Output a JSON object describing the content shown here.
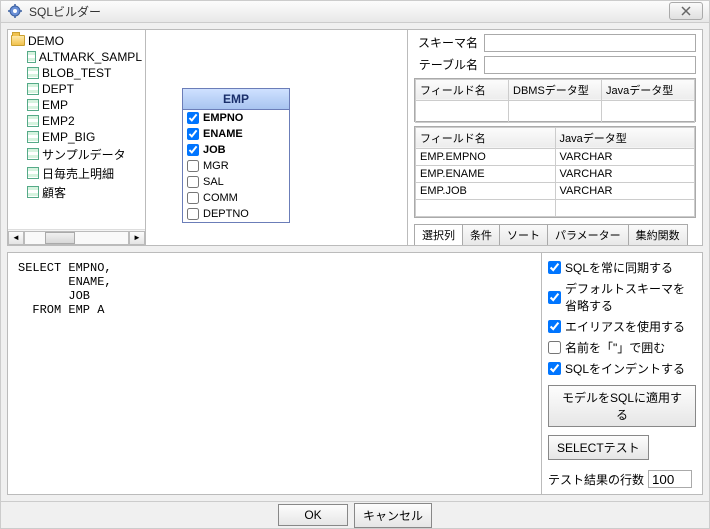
{
  "title": "SQLビルダー",
  "tree": {
    "root": "DEMO",
    "items": [
      "ALTMARK_SAMPL",
      "BLOB_TEST",
      "DEPT",
      "EMP",
      "EMP2",
      "EMP_BIG",
      "サンプルデータ",
      "日毎売上明細",
      "顧客"
    ]
  },
  "entity": {
    "name": "EMP",
    "columns": [
      {
        "name": "EMPNO",
        "checked": true,
        "bold": true
      },
      {
        "name": "ENAME",
        "checked": true,
        "bold": true
      },
      {
        "name": "JOB",
        "checked": true,
        "bold": true
      },
      {
        "name": "MGR",
        "checked": false,
        "bold": false
      },
      {
        "name": "SAL",
        "checked": false,
        "bold": false
      },
      {
        "name": "COMM",
        "checked": false,
        "bold": false
      },
      {
        "name": "DEPTNO",
        "checked": false,
        "bold": false
      }
    ]
  },
  "right": {
    "schema_label": "スキーマ名",
    "schema_value": "",
    "table_label": "テーブル名",
    "table_value": "",
    "grid1_headers": [
      "フィールド名",
      "DBMSデータ型",
      "Javaデータ型"
    ],
    "grid2_headers": [
      "フィールド名",
      "Javaデータ型"
    ],
    "grid2_rows": [
      {
        "field": "EMP.EMPNO",
        "java": "VARCHAR"
      },
      {
        "field": "EMP.ENAME",
        "java": "VARCHAR"
      },
      {
        "field": "EMP.JOB",
        "java": "VARCHAR"
      },
      {
        "field": "",
        "java": ""
      }
    ],
    "tabs": [
      "選択列",
      "条件",
      "ソート",
      "パラメーター",
      "集約関数"
    ]
  },
  "sql": "SELECT EMPNO,\n       ENAME,\n       JOB\n  FROM EMP A",
  "options": {
    "chk1": {
      "label": "SQLを常に同期する",
      "checked": true
    },
    "chk2": {
      "label": "デフォルトスキーマを省略する",
      "checked": true
    },
    "chk3": {
      "label": "エイリアスを使用する",
      "checked": true
    },
    "chk4": {
      "label": "名前を「\"」で囲む",
      "checked": false
    },
    "chk5": {
      "label": "SQLをインデントする",
      "checked": true
    },
    "apply_btn": "モデルをSQLに適用する",
    "select_test_btn": "SELECTテスト",
    "result_label": "テスト結果の行数",
    "result_value": "100"
  },
  "footer": {
    "ok": "OK",
    "cancel": "キャンセル"
  }
}
